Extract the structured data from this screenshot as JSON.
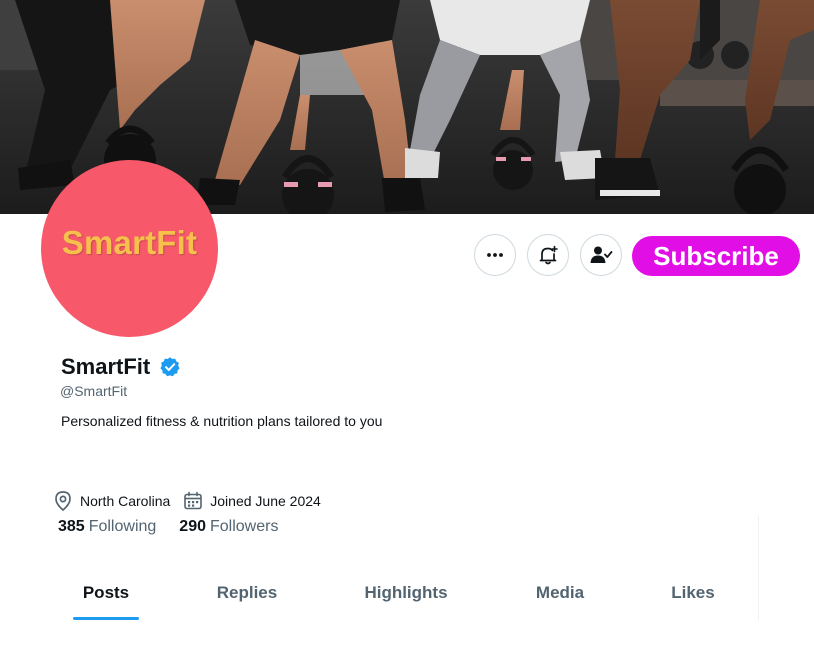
{
  "banner": {
    "icon": "kettlebell-workout-photo"
  },
  "avatar": {
    "text": "SmartFit",
    "bg": "#f7596a",
    "text_color": "#f5c04b"
  },
  "actions": {
    "more_icon": "more-horizontal-icon",
    "notify_icon": "bell-plus-icon",
    "follow_icon": "user-check-icon",
    "subscribe_label": "Subscribe",
    "subscribe_color": "#e20ee6"
  },
  "profile": {
    "name": "SmartFit",
    "verified": true,
    "handle": "@SmartFit",
    "bio": "Personalized fitness & nutrition plans tailored to you",
    "location": "North Carolina",
    "joined": "Joined June 2024"
  },
  "stats": {
    "following_count": "385",
    "following_label": "Following",
    "followers_count": "290",
    "followers_label": "Followers"
  },
  "tabs": [
    {
      "label": "Posts",
      "active": true
    },
    {
      "label": "Replies",
      "active": false
    },
    {
      "label": "Highlights",
      "active": false
    },
    {
      "label": "Media",
      "active": false
    },
    {
      "label": "Likes",
      "active": false
    }
  ],
  "colors": {
    "accent": "#1d9bf0",
    "secondary_text": "#536471"
  }
}
